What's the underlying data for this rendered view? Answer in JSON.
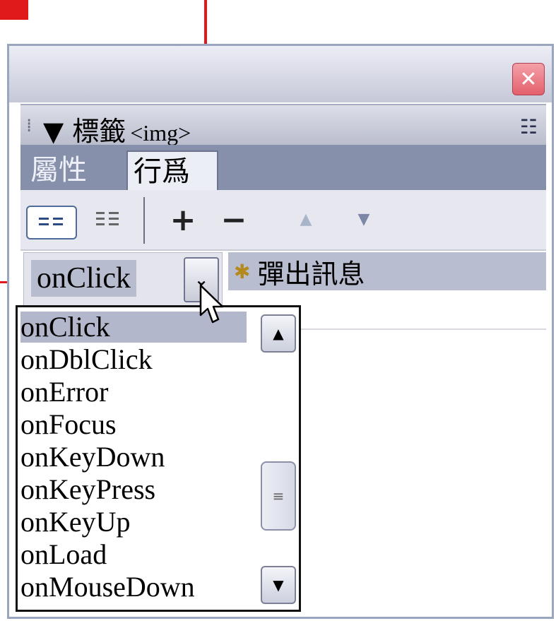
{
  "panel": {
    "close_glyph": "✕",
    "tag_title_prefix": "▼ 標籤",
    "tag_title_code": "<img>",
    "menu_glyph": "☷"
  },
  "tabs": [
    {
      "label": "屬性",
      "active": false
    },
    {
      "label": "行爲",
      "active": true
    }
  ],
  "toolbar": {
    "add_label": "+",
    "remove_label": "−",
    "up_glyph": "▲",
    "down_glyph": "▼"
  },
  "event": {
    "selected": "onClick",
    "action": "彈出訊息"
  },
  "dropdown": {
    "items": [
      "onClick",
      "onDblClick",
      "onError",
      "onFocus",
      "onKeyDown",
      "onKeyPress",
      "onKeyUp",
      "onLoad",
      "onMouseDown"
    ],
    "selected_index": 0
  },
  "colors": {
    "callout": "#e01a1a",
    "selection": "#b8bccf"
  }
}
